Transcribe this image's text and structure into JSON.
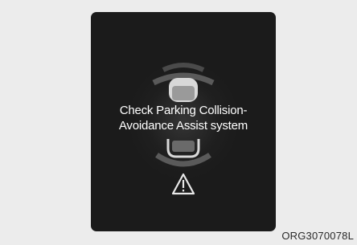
{
  "display": {
    "message_line1": "Check Parking Collision-",
    "message_line2": "Avoidance Assist system",
    "warning_icon": "warning-triangle-icon",
    "car_icon": "car-top-view-icon",
    "colors": {
      "screen_background": "#1b1b1b",
      "text": "#ffffff",
      "sensor_zone": "#5a5a5a"
    }
  },
  "figure": {
    "code": "ORG3070078L"
  }
}
